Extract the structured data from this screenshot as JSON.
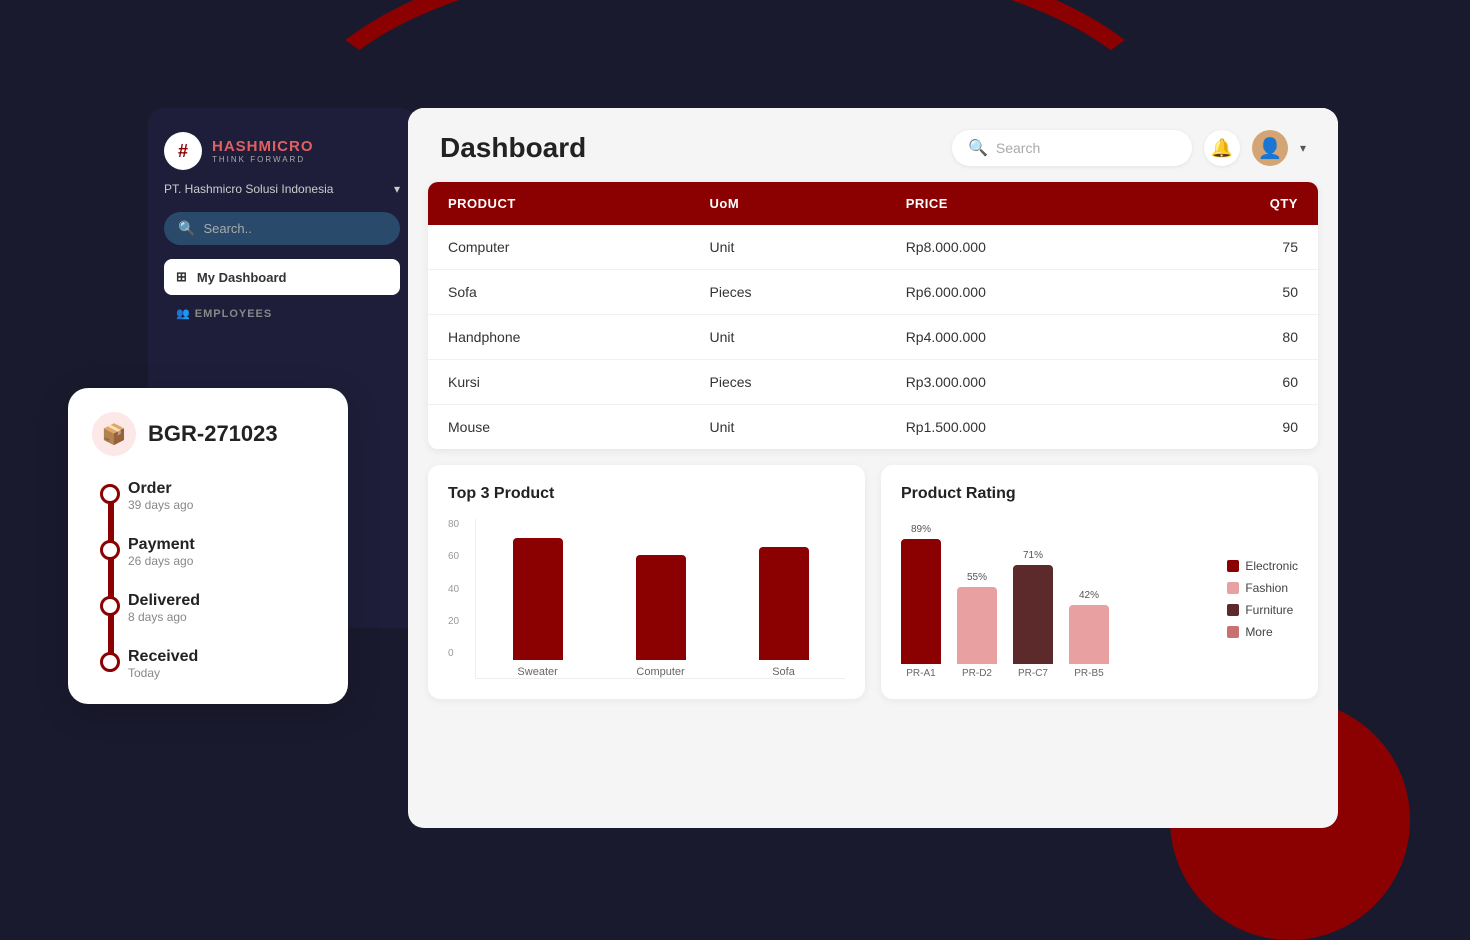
{
  "app": {
    "brand": {
      "name_part1": "HASH",
      "name_part2": "MICRO",
      "tagline": "THINK FORWARD",
      "icon": "#"
    },
    "company": "PT. Hashmicro Solusi Indonesia",
    "sidebar_search_placeholder": "Search.."
  },
  "sidebar": {
    "nav_items": [
      {
        "id": "dashboard",
        "label": "My Dashboard",
        "active": true,
        "icon": "grid"
      },
      {
        "id": "employees",
        "label": "EMPLOYEES",
        "section": true
      }
    ]
  },
  "header": {
    "title": "Dashboard",
    "search_placeholder": "Search",
    "search_label": "Search"
  },
  "table": {
    "columns": [
      "PRODUCT",
      "UoM",
      "PRICE",
      "QTY"
    ],
    "rows": [
      {
        "product": "Computer",
        "uom": "Unit",
        "price": "Rp8.000.000",
        "qty": "75"
      },
      {
        "product": "Sofa",
        "uom": "Pieces",
        "price": "Rp6.000.000",
        "qty": "50"
      },
      {
        "product": "Handphone",
        "uom": "Unit",
        "price": "Rp4.000.000",
        "qty": "80"
      },
      {
        "product": "Kursi",
        "uom": "Pieces",
        "price": "Rp3.000.000",
        "qty": "60"
      },
      {
        "product": "Mouse",
        "uom": "Unit",
        "price": "Rp1.500.000",
        "qty": "90"
      }
    ]
  },
  "top3_chart": {
    "title": "Top 3 Product",
    "y_labels": [
      "0",
      "20",
      "40",
      "60",
      "80"
    ],
    "bars": [
      {
        "label": "Sweater",
        "value": 70,
        "height_pct": 87
      },
      {
        "label": "Computer",
        "value": 60,
        "height_pct": 75
      },
      {
        "label": "Sofa",
        "value": 65,
        "height_pct": 81
      }
    ]
  },
  "rating_chart": {
    "title": "Product Rating",
    "bars": [
      {
        "id": "PR-A1",
        "pct": "89%",
        "value": 89,
        "color": "#8b0000"
      },
      {
        "id": "PR-D2",
        "pct": "55%",
        "value": 55,
        "color": "#e8a0a0"
      },
      {
        "id": "PR-C7",
        "pct": "71%",
        "value": 71,
        "color": "#5c2a2a"
      },
      {
        "id": "PR-B5",
        "pct": "42%",
        "value": 42,
        "color": "#e8a0a0"
      }
    ],
    "legend": [
      {
        "label": "Electronic",
        "color": "#8b0000"
      },
      {
        "label": "Fashion",
        "color": "#e8a0a0"
      },
      {
        "label": "Furniture",
        "color": "#5c2a2a"
      },
      {
        "label": "More",
        "color": "#c97070"
      }
    ]
  },
  "order_card": {
    "id": "BGR-271023",
    "steps": [
      {
        "title": "Order",
        "time": "39 days ago"
      },
      {
        "title": "Payment",
        "time": "26 days ago"
      },
      {
        "title": "Delivered",
        "time": "8 days ago"
      },
      {
        "title": "Received",
        "time": "Today"
      }
    ]
  },
  "colors": {
    "primary": "#8b0000",
    "accent": "#e8a0a0",
    "sidebar_bg": "#1e1e3a",
    "sidebar_search": "#2a4a6b"
  }
}
